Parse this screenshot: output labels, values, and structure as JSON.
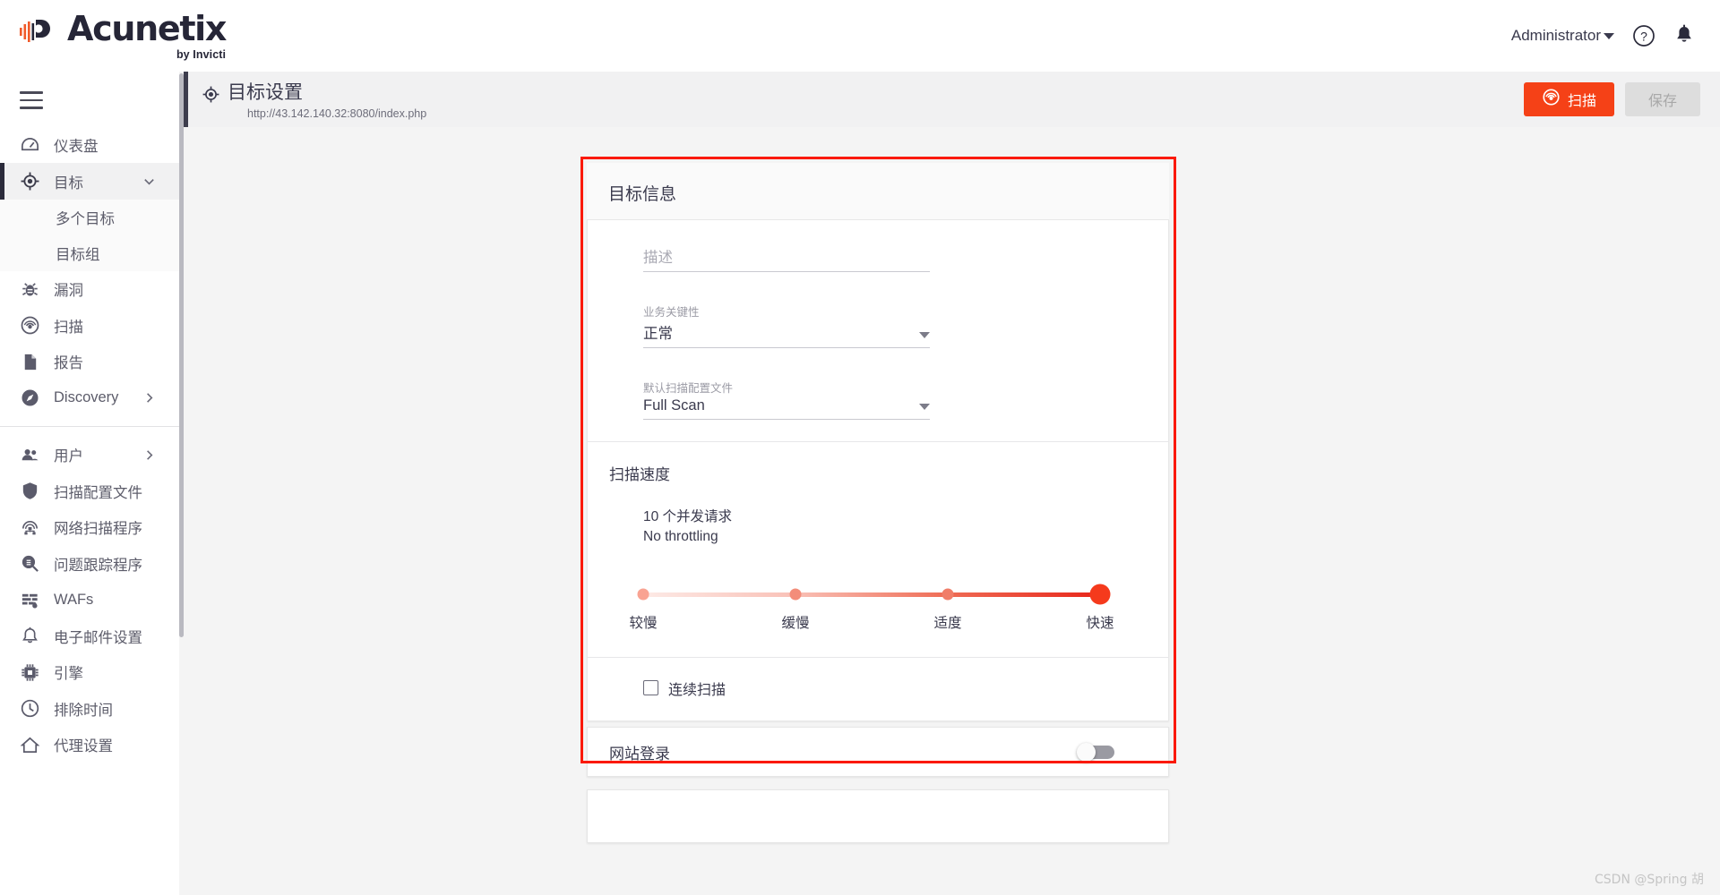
{
  "brand": {
    "name": "Acunetix",
    "tagline": "by Invicti"
  },
  "topbar": {
    "user": "Administrator",
    "help_icon": "question-circle-icon",
    "bell_icon": "bell-icon"
  },
  "sidebar": {
    "menu_icon": "hamburger-icon",
    "items": [
      {
        "label": "仪表盘",
        "icon": "dashboard-icon",
        "active": false,
        "chevron": ""
      },
      {
        "label": "目标",
        "icon": "target-icon",
        "active": true,
        "chevron": "down"
      },
      {
        "label": "漏洞",
        "icon": "bug-icon",
        "active": false,
        "chevron": ""
      },
      {
        "label": "扫描",
        "icon": "scan-icon",
        "active": false,
        "chevron": ""
      },
      {
        "label": "报告",
        "icon": "report-icon",
        "active": false,
        "chevron": ""
      },
      {
        "label": "Discovery",
        "icon": "compass-icon",
        "active": false,
        "chevron": "right"
      }
    ],
    "sub_items": [
      {
        "label": "多个目标"
      },
      {
        "label": "目标组"
      }
    ],
    "items2": [
      {
        "label": "用户",
        "icon": "users-icon",
        "chevron": "right"
      },
      {
        "label": "扫描配置文件",
        "icon": "shield-icon",
        "chevron": ""
      },
      {
        "label": "网络扫描程序",
        "icon": "network-scanner-icon",
        "chevron": ""
      },
      {
        "label": "问题跟踪程序",
        "icon": "issue-tracker-icon",
        "chevron": ""
      },
      {
        "label": "WAFs",
        "icon": "waf-icon",
        "chevron": ""
      },
      {
        "label": "电子邮件设置",
        "icon": "bell-outline-icon",
        "chevron": ""
      },
      {
        "label": "引擎",
        "icon": "engine-icon",
        "chevron": ""
      },
      {
        "label": "排除时间",
        "icon": "clock-icon",
        "chevron": ""
      },
      {
        "label": "代理设置",
        "icon": "proxy-icon",
        "chevron": ""
      }
    ]
  },
  "page_header": {
    "icon": "target-icon",
    "title": "目标设置",
    "subtitle": "http://43.142.140.32:8080/index.php",
    "scan_button": "扫描",
    "scan_button_icon": "scan-icon",
    "save_button": "保存"
  },
  "target_info": {
    "card_title": "目标信息",
    "description": {
      "label": "",
      "placeholder": "描述",
      "value": ""
    },
    "business_criticality": {
      "label": "业务关键性",
      "value": "正常"
    },
    "default_scan_profile": {
      "label": "默认扫描配置文件",
      "value": "Full Scan"
    }
  },
  "scan_speed": {
    "title": "扫描速度",
    "concurrent_line": "10 个并发请求",
    "throttle_line": "No throttling",
    "ticks": [
      "较慢",
      "缓慢",
      "适度",
      "快速"
    ],
    "selected_index": 3,
    "continuous_scan_label": "连续扫描",
    "continuous_scan_checked": false
  },
  "website_login": {
    "title": "网站登录",
    "enabled": false
  },
  "colors": {
    "accent": "#f54117",
    "outline": "#fb1902",
    "slider_end": "#f53a1c",
    "sidebar_text": "#5c5c6a"
  },
  "watermark": "CSDN @Spring 胡"
}
